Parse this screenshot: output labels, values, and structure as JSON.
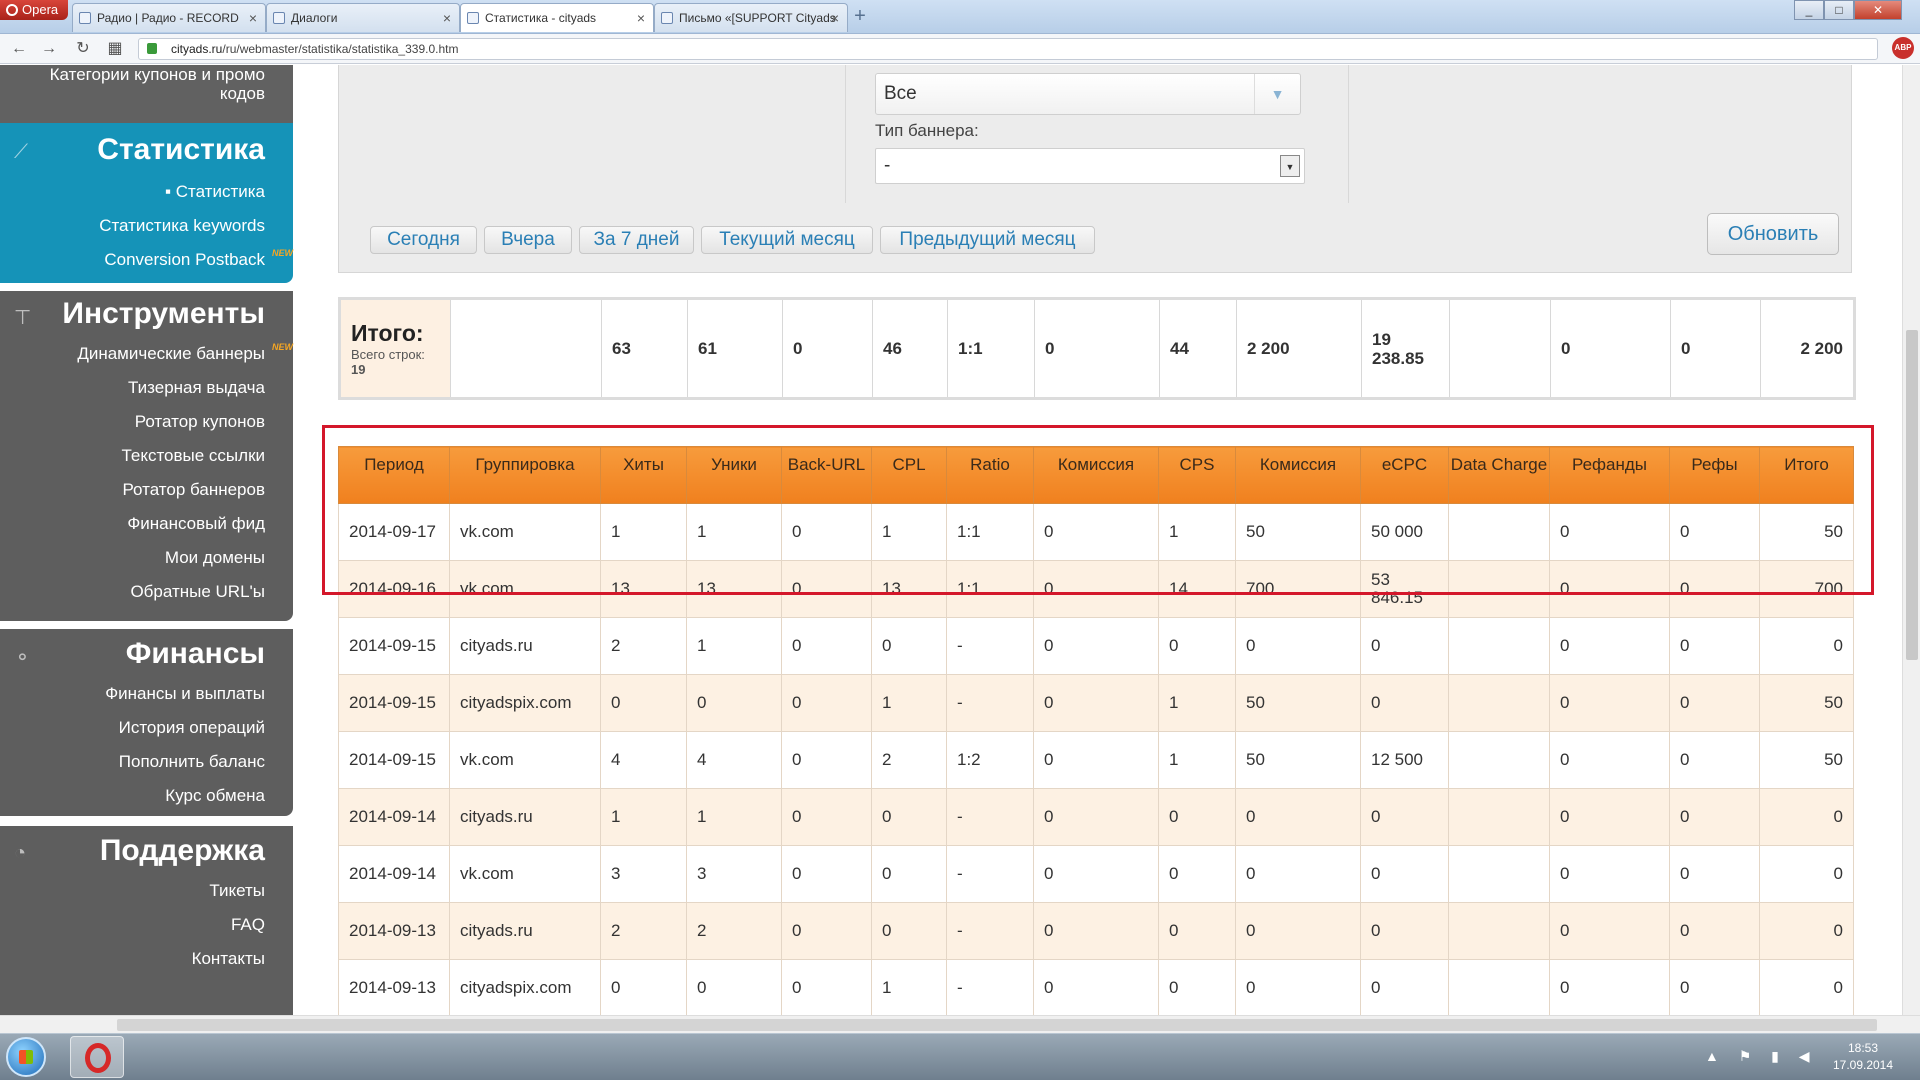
{
  "browser": {
    "menu_label": "Opera",
    "tabs": [
      {
        "label": "Радио | Радио - RECORD",
        "close": "×"
      },
      {
        "label": "Диалоги",
        "close": "×"
      },
      {
        "label": "Статистика - cityads",
        "close": "×"
      },
      {
        "label": "Письмо «[SUPPORT Cityads",
        "close": "×"
      }
    ],
    "new_tab": "+",
    "url_domain": "cityads.ru",
    "url_path": "/ru/webmaster/statistika/statistika_339.0.htm",
    "adblock": "ABP"
  },
  "sidebar": {
    "coupons_label": "Категории купонов и промо кодов",
    "stats": {
      "title": "Статистика",
      "items": [
        "Статистика",
        "Статистика keywords",
        "Conversion Postback"
      ],
      "new_badge": "NEW"
    },
    "tools": {
      "title": "Инструменты",
      "items": [
        "Динамические баннеры",
        "Тизерная выдача",
        "Ротатор купонов",
        "Текстовые ссылки",
        "Ротатор баннеров",
        "Финансовый фид",
        "Мои домены",
        "Обратные URL'ы"
      ],
      "new_badge": "NEW"
    },
    "finance": {
      "title": "Финансы",
      "items": [
        "Финансы и выплаты",
        "История операций",
        "Пополнить баланс",
        "Курс обмена"
      ]
    },
    "support": {
      "title": "Поддержка",
      "items": [
        "Тикеты",
        "FAQ",
        "Контакты"
      ]
    }
  },
  "filters": {
    "select1_value": "Все",
    "banner_type_label": "Тип баннера:",
    "banner_type_value": "-",
    "periods": [
      "Сегодня",
      "Вчера",
      "За 7 дней",
      "Текущий месяц",
      "Предыдущий месяц"
    ],
    "refresh": "Обновить"
  },
  "totals": {
    "title": "Итого:",
    "rows_label": "Всего строк:",
    "rows_count": "19",
    "values": [
      "",
      "63",
      "61",
      "0",
      "46",
      "1:1",
      "0",
      "44",
      "2 200",
      "19 238.85",
      "",
      "0",
      "0",
      "2 200"
    ]
  },
  "table": {
    "headers": [
      "Период",
      "Группировка",
      "Хиты",
      "Уники",
      "Back-URL",
      "CPL",
      "Ratio",
      "Комиссия",
      "CPS",
      "Комиссия",
      "eCPC",
      "Data Charge",
      "Рефанды",
      "Рефы",
      "Итого"
    ],
    "rows": [
      [
        "2014-09-17",
        "vk.com",
        "1",
        "1",
        "0",
        "1",
        "1:1",
        "0",
        "1",
        "50",
        "50 000",
        "",
        "0",
        "0",
        "50"
      ],
      [
        "2014-09-16",
        "vk.com",
        "13",
        "13",
        "0",
        "13",
        "1:1",
        "0",
        "14",
        "700",
        "53 846.15",
        "",
        "0",
        "0",
        "700"
      ],
      [
        "2014-09-15",
        "cityads.ru",
        "2",
        "1",
        "0",
        "0",
        "-",
        "0",
        "0",
        "0",
        "0",
        "",
        "0",
        "0",
        "0"
      ],
      [
        "2014-09-15",
        "cityadspix.com",
        "0",
        "0",
        "0",
        "1",
        "-",
        "0",
        "1",
        "50",
        "0",
        "",
        "0",
        "0",
        "50"
      ],
      [
        "2014-09-15",
        "vk.com",
        "4",
        "4",
        "0",
        "2",
        "1:2",
        "0",
        "1",
        "50",
        "12 500",
        "",
        "0",
        "0",
        "50"
      ],
      [
        "2014-09-14",
        "cityads.ru",
        "1",
        "1",
        "0",
        "0",
        "-",
        "0",
        "0",
        "0",
        "0",
        "",
        "0",
        "0",
        "0"
      ],
      [
        "2014-09-14",
        "vk.com",
        "3",
        "3",
        "0",
        "0",
        "-",
        "0",
        "0",
        "0",
        "0",
        "",
        "0",
        "0",
        "0"
      ],
      [
        "2014-09-13",
        "cityads.ru",
        "2",
        "2",
        "0",
        "0",
        "-",
        "0",
        "0",
        "0",
        "0",
        "",
        "0",
        "0",
        "0"
      ],
      [
        "2014-09-13",
        "cityadspix.com",
        "0",
        "0",
        "0",
        "1",
        "-",
        "0",
        "0",
        "0",
        "0",
        "",
        "0",
        "0",
        "0"
      ]
    ]
  },
  "taskbar": {
    "time": "18:53",
    "date": "17.09.2014"
  },
  "colors": {
    "stats_block": "#1593b8",
    "dark_block": "#5e5e5e",
    "header_orange": "#f0801e",
    "row_alt": "#fdf1e3",
    "highlight": "#d4172a",
    "link_blue": "#2a7fb5"
  }
}
